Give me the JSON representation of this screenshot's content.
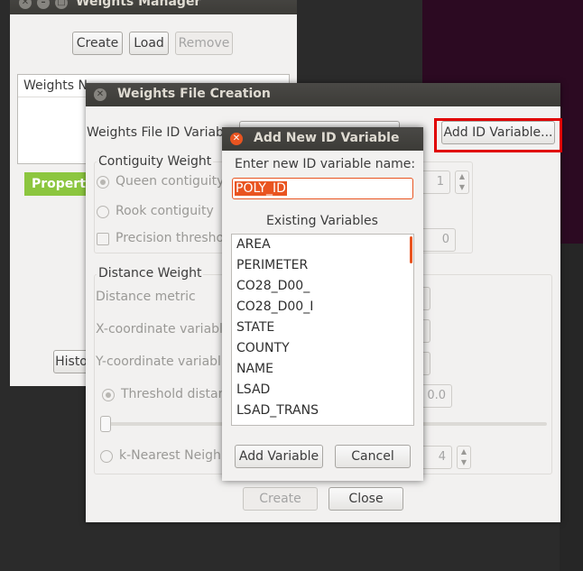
{
  "weights_manager": {
    "title": "Weights Manager",
    "create_label": "Create",
    "load_label": "Load",
    "remove_label": "Remove",
    "list_header": "Weights N",
    "properties_tab": "Propert",
    "history_button": "Histo"
  },
  "weights_file_creation": {
    "title": "Weights File Creation",
    "id_variable_label": "Weights File ID Variab",
    "add_id_variable_button": "Add ID Variable...",
    "contiguity_header": "Contiguity Weight",
    "queen_label": "Queen contiguity",
    "rook_label": "Rook contiguity",
    "precision_label": "Precision thresho",
    "order_value": "1",
    "precision_value": "0",
    "distance_header": "Distance Weight",
    "distance_metric_label": "Distance metric",
    "x_coord_label": "X-coordinate variabl",
    "y_coord_label": "Y-coordinate variabl",
    "threshold_label": "Threshold distan",
    "threshold_value": "0.0",
    "knn_label": "k-Nearest Neighb",
    "knn_value": "4",
    "create_label": "Create",
    "close_label": "Close"
  },
  "add_new_id_variable": {
    "title": "Add New ID Variable",
    "prompt": "Enter new ID variable name:",
    "input_value": "POLY_ID",
    "existing_header": "Existing Variables",
    "variables": [
      "AREA",
      "PERIMETER",
      "CO28_D00_",
      "CO28_D00_I",
      "STATE",
      "COUNTY",
      "NAME",
      "LSAD",
      "LSAD_TRANS"
    ],
    "add_button": "Add Variable",
    "cancel_button": "Cancel"
  },
  "colors": {
    "accent": "#e95420",
    "highlight": "#e00000",
    "properties_tab": "#8cc63f"
  }
}
